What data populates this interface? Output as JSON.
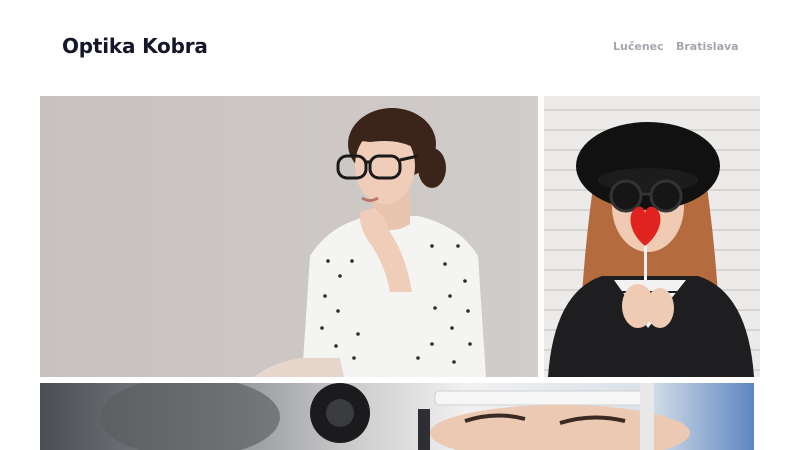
{
  "site": {
    "brand": "Optika Kobra"
  },
  "nav": {
    "items": [
      {
        "label": "Lučenec"
      },
      {
        "label": "Bratislava"
      }
    ]
  },
  "gallery": {
    "tiles": [
      {
        "subject": "woman-in-eyeglasses-thinking"
      },
      {
        "subject": "woman-in-sunglasses-with-heart-lollipop"
      },
      {
        "subject": "eye-examination"
      }
    ]
  },
  "colors": {
    "brand_text": "#16162b",
    "nav_text": "#a5a5ad",
    "background": "#ffffff"
  }
}
